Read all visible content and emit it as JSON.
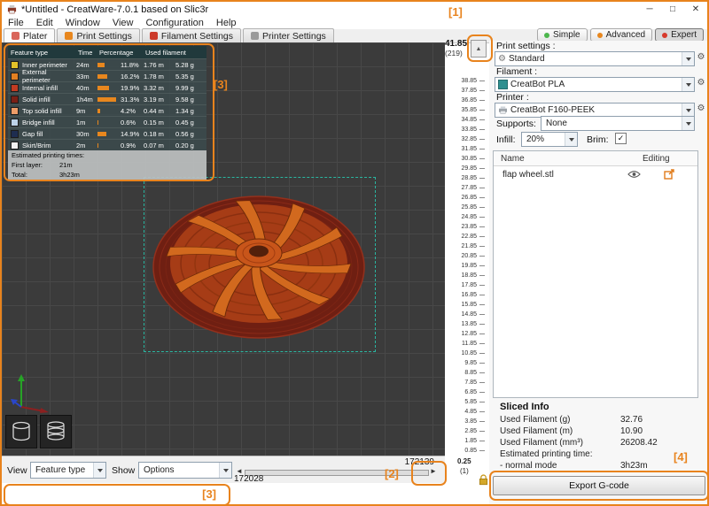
{
  "annotation_color": "#e8831d",
  "icons": {
    "up_arrow": "▲",
    "left_arrow": "◄",
    "right_arrow": "►",
    "gear": "⚙",
    "check": "✓"
  },
  "window": {
    "title": "*Untitled - CreatWare-7.0.1 based on Slic3r",
    "minimize": "─",
    "maximize": "□",
    "close": "✕"
  },
  "menu": [
    "File",
    "Edit",
    "Window",
    "View",
    "Configuration",
    "Help"
  ],
  "tabs": [
    {
      "label": "Plater",
      "color": "#d9655a",
      "active": true
    },
    {
      "label": "Print Settings",
      "color": "#e8871e",
      "active": false
    },
    {
      "label": "Filament Settings",
      "color": "#cc3a2a",
      "active": false
    },
    {
      "label": "Printer Settings",
      "color": "#9a9a9a",
      "active": false
    }
  ],
  "modes": [
    {
      "label": "Simple",
      "color": "#4cb64c",
      "active": false
    },
    {
      "label": "Advanced",
      "color": "#e8871e",
      "active": false
    },
    {
      "label": "Expert",
      "color": "#d7392b",
      "active": true
    }
  ],
  "legend": {
    "headers": [
      "Feature type",
      "Time",
      "Percentage",
      "Used filament"
    ],
    "rows": [
      {
        "name": "Inner perimeter",
        "color": "#e3c229",
        "time": "24m",
        "pct": 11.8,
        "pct_label": "11.8%",
        "len": "1.76 m",
        "wt": "5.28 g"
      },
      {
        "name": "External perimeter",
        "color": "#e28022",
        "time": "33m",
        "pct": 16.2,
        "pct_label": "16.2%",
        "len": "1.78 m",
        "wt": "5.35 g"
      },
      {
        "name": "Internal infill",
        "color": "#c23b22",
        "time": "40m",
        "pct": 19.9,
        "pct_label": "19.9%",
        "len": "3.32 m",
        "wt": "9.99 g"
      },
      {
        "name": "Solid infill",
        "color": "#7a2016",
        "time": "1h4m",
        "pct": 31.3,
        "pct_label": "31.3%",
        "len": "3.19 m",
        "wt": "9.58 g"
      },
      {
        "name": "Top solid infill",
        "color": "#ef9d68",
        "time": "9m",
        "pct": 4.2,
        "pct_label": "4.2%",
        "len": "0.44 m",
        "wt": "1.34 g"
      },
      {
        "name": "Bridge infill",
        "color": "#bcd2e8",
        "time": "1m",
        "pct": 0.6,
        "pct_label": "0.6%",
        "len": "0.15 m",
        "wt": "0.45 g"
      },
      {
        "name": "Gap fill",
        "color": "#1e2d50",
        "time": "30m",
        "pct": 14.9,
        "pct_label": "14.9%",
        "len": "0.18 m",
        "wt": "0.56 g"
      },
      {
        "name": "Skirt/Brim",
        "color": "#f2f2f2",
        "time": "2m",
        "pct": 0.9,
        "pct_label": "0.9%",
        "len": "0.07 m",
        "wt": "0.20 g"
      }
    ],
    "est_title": "Estimated printing times:",
    "first_layer_label": "First layer:",
    "first_layer_value": "21m",
    "total_label": "Total:",
    "total_value": "3h23m"
  },
  "layer_scale": {
    "top_value": "41.85",
    "top_count": "(219)",
    "ticks": [
      "38.85",
      "37.85",
      "36.85",
      "35.85",
      "34.85",
      "33.85",
      "32.85",
      "31.85",
      "30.85",
      "29.85",
      "28.85",
      "27.85",
      "26.85",
      "25.85",
      "24.85",
      "23.85",
      "22.85",
      "21.85",
      "20.85",
      "19.85",
      "18.85",
      "17.85",
      "16.85",
      "15.85",
      "14.85",
      "13.85",
      "12.85",
      "11.85",
      "10.85",
      "9.85",
      "8.85",
      "7.85",
      "6.85",
      "5.85",
      "4.85",
      "3.85",
      "2.85",
      "1.85",
      "0.85"
    ],
    "bottom_value": "0.25",
    "bottom_count": "(1)"
  },
  "panel": {
    "print_settings_label": "Print settings :",
    "print_settings_value": "Standard",
    "filament_label": "Filament :",
    "filament_value": "CreatBot PLA",
    "filament_color": "#2e8f8f",
    "printer_label": "Printer :",
    "printer_value": "CreatBot F160-PEEK",
    "supports_label": "Supports:",
    "supports_value": "None",
    "infill_label": "Infill:",
    "infill_value": "20%",
    "brim_label": "Brim:",
    "files": {
      "header_name": "Name",
      "header_editing": "Editing",
      "rows": [
        {
          "name": "flap wheel.stl"
        }
      ]
    },
    "sliced": {
      "title": "Sliced Info",
      "rows": [
        {
          "label": "Used Filament (g)",
          "value": "32.76"
        },
        {
          "label": "Used Filament (m)",
          "value": "10.90"
        },
        {
          "label": "Used Filament (mm³)",
          "value": "26208.42"
        },
        {
          "label": "Estimated printing time:",
          "value": ""
        },
        {
          "label": "- normal mode",
          "value": "3h23m"
        }
      ]
    },
    "export_button": "Export G-code"
  },
  "bottom": {
    "view_label": "View",
    "view_value": "Feature type",
    "show_label": "Show",
    "show_value": "Options",
    "h_value_top": "172139",
    "h_value_bottom": "172028"
  },
  "annotations": {
    "layer_slider": "[1]",
    "horizontal_slider": "[2]",
    "legend_box": "[3]",
    "view_controls": "[3]",
    "export": "[4]"
  }
}
